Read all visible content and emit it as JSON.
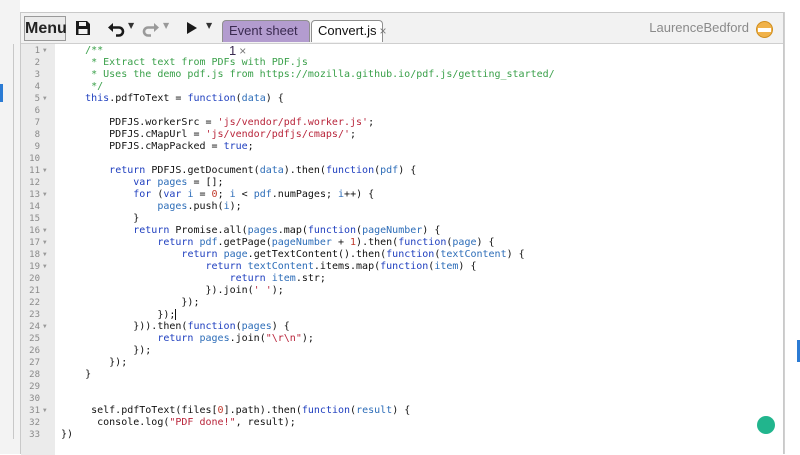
{
  "toolbar": {
    "menu_label": "Menu",
    "tabs": [
      {
        "label": "Event sheet 1",
        "close": "×",
        "active": false
      },
      {
        "label": "Convert.js",
        "close": "×",
        "active": true
      }
    ],
    "user_name": "LaurenceBedford"
  },
  "editor": {
    "lines": [
      {
        "n": "1",
        "fold": true,
        "segs": [
          [
            "c",
            "    /**"
          ]
        ]
      },
      {
        "n": "2",
        "fold": false,
        "segs": [
          [
            "c",
            "     * Extract text from PDFs with PDF.js"
          ]
        ]
      },
      {
        "n": "3",
        "fold": false,
        "segs": [
          [
            "c",
            "     * Uses the demo pdf.js from https://mozilla.github.io/pdf.js/getting_started/"
          ]
        ]
      },
      {
        "n": "4",
        "fold": false,
        "segs": [
          [
            "c",
            "     */"
          ]
        ]
      },
      {
        "n": "5",
        "fold": true,
        "segs": [
          [
            "p",
            "    "
          ],
          [
            "k",
            "this"
          ],
          [
            "p",
            ".pdfToText = "
          ],
          [
            "k",
            "function"
          ],
          [
            "p",
            "("
          ],
          [
            "v",
            "data"
          ],
          [
            "p",
            ") {"
          ]
        ]
      },
      {
        "n": "6",
        "fold": false,
        "segs": []
      },
      {
        "n": "7",
        "fold": false,
        "segs": [
          [
            "p",
            "        PDFJS.workerSrc = "
          ],
          [
            "s",
            "'js/vendor/pdf.worker.js'"
          ],
          [
            "p",
            ";"
          ]
        ]
      },
      {
        "n": "8",
        "fold": false,
        "segs": [
          [
            "p",
            "        PDFJS.cMapUrl = "
          ],
          [
            "s",
            "'js/vendor/pdfjs/cmaps/'"
          ],
          [
            "p",
            ";"
          ]
        ]
      },
      {
        "n": "9",
        "fold": false,
        "segs": [
          [
            "p",
            "        PDFJS.cMapPacked = "
          ],
          [
            "k",
            "true"
          ],
          [
            "p",
            ";"
          ]
        ]
      },
      {
        "n": "10",
        "fold": false,
        "segs": []
      },
      {
        "n": "11",
        "fold": true,
        "segs": [
          [
            "p",
            "        "
          ],
          [
            "k",
            "return"
          ],
          [
            "p",
            " PDFJS.getDocument("
          ],
          [
            "v",
            "data"
          ],
          [
            "p",
            ").then("
          ],
          [
            "k",
            "function"
          ],
          [
            "p",
            "("
          ],
          [
            "v",
            "pdf"
          ],
          [
            "p",
            ") {"
          ]
        ]
      },
      {
        "n": "12",
        "fold": false,
        "segs": [
          [
            "p",
            "            "
          ],
          [
            "k",
            "var"
          ],
          [
            "p",
            " "
          ],
          [
            "v",
            "pages"
          ],
          [
            "p",
            " = [];"
          ]
        ]
      },
      {
        "n": "13",
        "fold": true,
        "segs": [
          [
            "p",
            "            "
          ],
          [
            "k",
            "for"
          ],
          [
            "p",
            " ("
          ],
          [
            "k",
            "var"
          ],
          [
            "p",
            " "
          ],
          [
            "v",
            "i"
          ],
          [
            "p",
            " = "
          ],
          [
            "n",
            "0"
          ],
          [
            "p",
            "; "
          ],
          [
            "v",
            "i"
          ],
          [
            "p",
            " < "
          ],
          [
            "v",
            "pdf"
          ],
          [
            "p",
            ".numPages; "
          ],
          [
            "v",
            "i"
          ],
          [
            "p",
            "++) {"
          ]
        ]
      },
      {
        "n": "14",
        "fold": false,
        "segs": [
          [
            "p",
            "                "
          ],
          [
            "v",
            "pages"
          ],
          [
            "p",
            ".push("
          ],
          [
            "v",
            "i"
          ],
          [
            "p",
            ");"
          ]
        ]
      },
      {
        "n": "15",
        "fold": false,
        "segs": [
          [
            "p",
            "            }"
          ]
        ]
      },
      {
        "n": "16",
        "fold": true,
        "segs": [
          [
            "p",
            "            "
          ],
          [
            "k",
            "return"
          ],
          [
            "p",
            " Promise.all("
          ],
          [
            "v",
            "pages"
          ],
          [
            "p",
            ".map("
          ],
          [
            "k",
            "function"
          ],
          [
            "p",
            "("
          ],
          [
            "v",
            "pageNumber"
          ],
          [
            "p",
            ") {"
          ]
        ]
      },
      {
        "n": "17",
        "fold": true,
        "segs": [
          [
            "p",
            "                "
          ],
          [
            "k",
            "return"
          ],
          [
            "p",
            " "
          ],
          [
            "v",
            "pdf"
          ],
          [
            "p",
            ".getPage("
          ],
          [
            "v",
            "pageNumber"
          ],
          [
            "p",
            " + "
          ],
          [
            "n",
            "1"
          ],
          [
            "p",
            ").then("
          ],
          [
            "k",
            "function"
          ],
          [
            "p",
            "("
          ],
          [
            "v",
            "page"
          ],
          [
            "p",
            ") {"
          ]
        ]
      },
      {
        "n": "18",
        "fold": true,
        "segs": [
          [
            "p",
            "                    "
          ],
          [
            "k",
            "return"
          ],
          [
            "p",
            " "
          ],
          [
            "v",
            "page"
          ],
          [
            "p",
            ".getTextContent().then("
          ],
          [
            "k",
            "function"
          ],
          [
            "p",
            "("
          ],
          [
            "v",
            "textContent"
          ],
          [
            "p",
            ") {"
          ]
        ]
      },
      {
        "n": "19",
        "fold": true,
        "segs": [
          [
            "p",
            "                        "
          ],
          [
            "k",
            "return"
          ],
          [
            "p",
            " "
          ],
          [
            "v",
            "textContent"
          ],
          [
            "p",
            ".items.map("
          ],
          [
            "k",
            "function"
          ],
          [
            "p",
            "("
          ],
          [
            "v",
            "item"
          ],
          [
            "p",
            ") {"
          ]
        ]
      },
      {
        "n": "20",
        "fold": false,
        "segs": [
          [
            "p",
            "                            "
          ],
          [
            "k",
            "return"
          ],
          [
            "p",
            " "
          ],
          [
            "v",
            "item"
          ],
          [
            "p",
            ".str;"
          ]
        ]
      },
      {
        "n": "21",
        "fold": false,
        "segs": [
          [
            "p",
            "                        }).join("
          ],
          [
            "s",
            "' '"
          ],
          [
            "p",
            ");"
          ]
        ]
      },
      {
        "n": "22",
        "fold": false,
        "segs": [
          [
            "p",
            "                    });"
          ]
        ]
      },
      {
        "n": "23",
        "fold": false,
        "segs": [
          [
            "p",
            "                });"
          ]
        ],
        "cursor": true
      },
      {
        "n": "24",
        "fold": true,
        "segs": [
          [
            "p",
            "            })).then("
          ],
          [
            "k",
            "function"
          ],
          [
            "p",
            "("
          ],
          [
            "v",
            "pages"
          ],
          [
            "p",
            ") {"
          ]
        ]
      },
      {
        "n": "25",
        "fold": false,
        "segs": [
          [
            "p",
            "                "
          ],
          [
            "k",
            "return"
          ],
          [
            "p",
            " "
          ],
          [
            "v",
            "pages"
          ],
          [
            "p",
            ".join("
          ],
          [
            "s",
            "\"\\r\\n\""
          ],
          [
            "p",
            ");"
          ]
        ]
      },
      {
        "n": "26",
        "fold": false,
        "segs": [
          [
            "p",
            "            });"
          ]
        ]
      },
      {
        "n": "27",
        "fold": false,
        "segs": [
          [
            "p",
            "        });"
          ]
        ]
      },
      {
        "n": "28",
        "fold": false,
        "segs": [
          [
            "p",
            "    }"
          ]
        ]
      },
      {
        "n": "29",
        "fold": false,
        "segs": []
      },
      {
        "n": "30",
        "fold": false,
        "segs": []
      },
      {
        "n": "31",
        "fold": true,
        "segs": [
          [
            "p",
            "     self.pdfToText(files["
          ],
          [
            "n",
            "0"
          ],
          [
            "p",
            "].path).then("
          ],
          [
            "k",
            "function"
          ],
          [
            "p",
            "("
          ],
          [
            "v",
            "result"
          ],
          [
            "p",
            ") {"
          ]
        ]
      },
      {
        "n": "32",
        "fold": false,
        "segs": [
          [
            "p",
            "      console.log("
          ],
          [
            "s",
            "\"PDF done!\""
          ],
          [
            "p",
            ", result);"
          ]
        ]
      },
      {
        "n": "33",
        "fold": false,
        "segs": [
          [
            "p",
            "})"
          ]
        ]
      }
    ]
  },
  "colors": {
    "c": "#3aa04a",
    "k": "#1f3fbf",
    "v": "#2d6db8",
    "s": "#b8243a",
    "n": "#c0392b",
    "p": "#111111",
    "tab_inactive": "#b39ccf",
    "status_dot": "#21b58d"
  },
  "icons": [
    "save-icon",
    "undo-icon",
    "redo-icon",
    "play-icon",
    "chevron-down-icon",
    "user-badge-icon"
  ]
}
